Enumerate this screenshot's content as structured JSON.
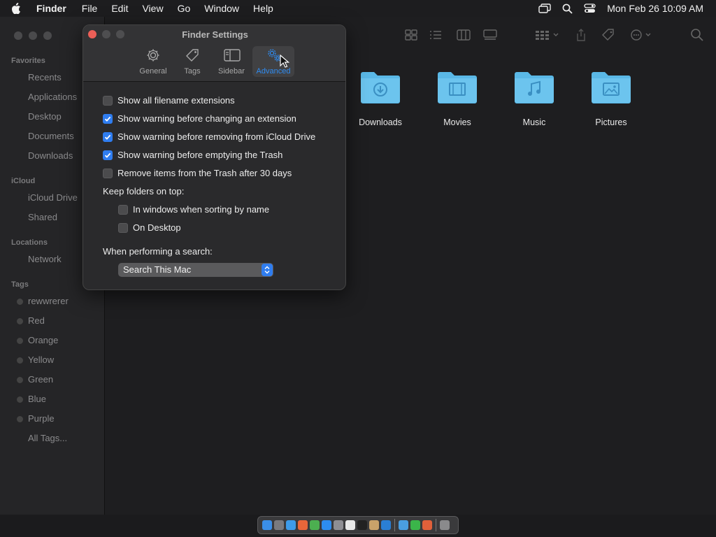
{
  "menubar": {
    "app": "Finder",
    "items": [
      "File",
      "Edit",
      "View",
      "Go",
      "Window",
      "Help"
    ],
    "clock": "Mon Feb 26  10:09 AM"
  },
  "sidebar": {
    "favorites_title": "Favorites",
    "favorites": [
      "Recents",
      "Applications",
      "Desktop",
      "Documents",
      "Downloads"
    ],
    "icloud_title": "iCloud",
    "icloud": [
      "iCloud Drive",
      "Shared"
    ],
    "locations_title": "Locations",
    "locations": [
      "Network"
    ],
    "tags_title": "Tags",
    "tags": [
      "rewwrerer",
      "Red",
      "Orange",
      "Yellow",
      "Green",
      "Blue",
      "Purple",
      "All Tags..."
    ]
  },
  "folders": [
    "Downloads",
    "Movies",
    "Music",
    "Pictures"
  ],
  "settings": {
    "title": "Finder Settings",
    "tabs": [
      "General",
      "Tags",
      "Sidebar",
      "Advanced"
    ],
    "active_tab": "Advanced",
    "options": [
      {
        "label": "Show all filename extensions",
        "checked": false
      },
      {
        "label": "Show warning before changing an extension",
        "checked": true
      },
      {
        "label": "Show warning before removing from iCloud Drive",
        "checked": true
      },
      {
        "label": "Show warning before emptying the Trash",
        "checked": true
      },
      {
        "label": "Remove items from the Trash after 30 days",
        "checked": false
      }
    ],
    "keep_folders_label": "Keep folders on top:",
    "keep_folders": [
      {
        "label": "In windows when sorting by name",
        "checked": false
      },
      {
        "label": "On Desktop",
        "checked": false
      }
    ],
    "search_label": "When performing a search:",
    "search_value": "Search This Mac"
  },
  "colors": {
    "accent": "#2f7df0",
    "folder": "#5ab8e6",
    "close": "#ec5f57"
  }
}
